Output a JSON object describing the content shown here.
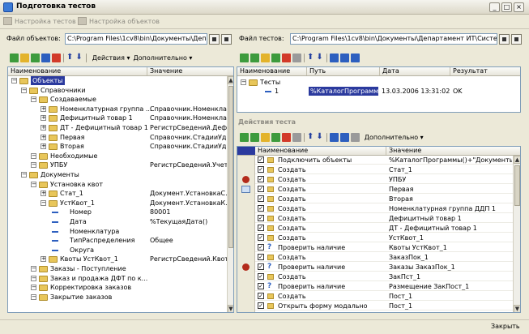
{
  "window": {
    "title": "Подготовка тестов",
    "minimize": "_",
    "maximize": "□",
    "close": "×"
  },
  "toolbar": {
    "tests_setup": "Настройка тестов",
    "objects_setup": "Настройка объектов"
  },
  "left": {
    "file_label": "Файл объектов:",
    "file_path": "C:\\Program Files\\1cv8\\bin\\Документы\\Департ",
    "actions_menu": "Действия",
    "more_menu": "Дополнительно",
    "columns": {
      "name": "Наименование",
      "value": "Значение"
    },
    "tree": [
      {
        "label": "Объекты",
        "value": "",
        "level": 0,
        "selected": true
      },
      {
        "label": "Справочники",
        "value": "",
        "level": 1
      },
      {
        "label": "Создаваемые",
        "value": "",
        "level": 2
      },
      {
        "label": "Номенклатурная группа ...",
        "value": "Справочник.Номенкла...",
        "level": 3
      },
      {
        "label": "Дефицитный товар 1",
        "value": "Справочник.Номенкла...",
        "level": 3
      },
      {
        "label": "ДТ - Дефицитный товар 1",
        "value": "РегистрСведений.Деф...",
        "level": 3
      },
      {
        "label": "Первая",
        "value": "Справочник.СтадииУд...",
        "level": 3
      },
      {
        "label": "Вторая",
        "value": "Справочник.СтадииУд...",
        "level": 3
      },
      {
        "label": "Необходимые",
        "value": "",
        "level": 2
      },
      {
        "label": "УПБУ",
        "value": "РегистрСведений.Учет...",
        "level": 2
      },
      {
        "label": "Документы",
        "value": "",
        "level": 1
      },
      {
        "label": "Установка квот",
        "value": "",
        "level": 2
      },
      {
        "label": "Стат_1",
        "value": "Документ.УстановкаС...",
        "level": 3
      },
      {
        "label": "УстКвот_1",
        "value": "Документ.УстановкаК...",
        "level": 3
      },
      {
        "label": "Номер",
        "value": "80001",
        "level": 4
      },
      {
        "label": "Дата",
        "value": "%ТекущаяДата()",
        "level": 4
      },
      {
        "label": "Номенклатура",
        "value": "",
        "level": 4
      },
      {
        "label": "ТипРаспределения",
        "value": "Общее",
        "level": 4
      },
      {
        "label": "Округа",
        "value": "",
        "level": 4
      },
      {
        "label": "Квоты УстКвот_1",
        "value": "РегистрСведений.Квот...",
        "level": 3
      },
      {
        "label": "Заказы - Поступление",
        "value": "",
        "level": 2
      },
      {
        "label": "Заказ и продажа ДФТ по к...",
        "value": "",
        "level": 2
      },
      {
        "label": "Корректировка заказов",
        "value": "",
        "level": 2
      },
      {
        "label": "Закрытие заказов",
        "value": "",
        "level": 2
      }
    ]
  },
  "right": {
    "file_label": "Файл тестов:",
    "file_path": "C:\\Program Files\\1cv8\\bin\\Документы\\Департамент ИТ\\Система",
    "tests_columns": {
      "name": "Наименование",
      "path": "Путь",
      "date": "Дата",
      "result": "Результат"
    },
    "tests_tree": [
      {
        "name": "Тесты",
        "path": "",
        "date": "",
        "result": ""
      },
      {
        "name": "1",
        "path": "%КаталогПрограмм\\...",
        "date": "13.03.2006 13:31:02",
        "result": "OK"
      }
    ],
    "actions_title": "Действия теста",
    "more_menu": "Дополнительно",
    "actions_columns": {
      "name": "Наименование",
      "value": "Значение"
    },
    "actions": [
      {
        "name": "Подключить объекты",
        "value": "%КаталогПрограммы()+\"Документы\\Д...",
        "marker": ""
      },
      {
        "name": "Создать",
        "value": "Стат_1",
        "marker": ""
      },
      {
        "name": "Создать",
        "value": "УПБУ",
        "marker": "red"
      },
      {
        "name": "Создать",
        "value": "Первая",
        "marker": "doc"
      },
      {
        "name": "Создать",
        "value": "Вторая",
        "marker": ""
      },
      {
        "name": "Создать",
        "value": "Номенклатурная группа ДДП 1",
        "marker": ""
      },
      {
        "name": "Создать",
        "value": "Дефицитный товар 1",
        "marker": ""
      },
      {
        "name": "Создать",
        "value": "ДТ - Дефицитный товар 1",
        "marker": ""
      },
      {
        "name": "Создать",
        "value": "УстКвот_1",
        "marker": ""
      },
      {
        "name": "Проверить наличие",
        "value": "Квоты УстКвот_1",
        "marker": ""
      },
      {
        "name": "Создать",
        "value": "ЗаказПок_1",
        "marker": ""
      },
      {
        "name": "Проверить наличие",
        "value": "Заказы ЗаказПок_1",
        "marker": "red"
      },
      {
        "name": "Создать",
        "value": "ЗакПст_1",
        "marker": ""
      },
      {
        "name": "Проверить наличие",
        "value": "Размещение ЗакПост_1",
        "marker": ""
      },
      {
        "name": "Создать",
        "value": "Пост_1",
        "marker": ""
      },
      {
        "name": "Открыть форму модально",
        "value": "Пост_1",
        "marker": ""
      }
    ]
  },
  "status": {
    "close_button": "Закрыть"
  },
  "colors": {
    "selection": "#2b3a9e",
    "marker": "#b32b1b",
    "folder": "#e8c65a"
  }
}
